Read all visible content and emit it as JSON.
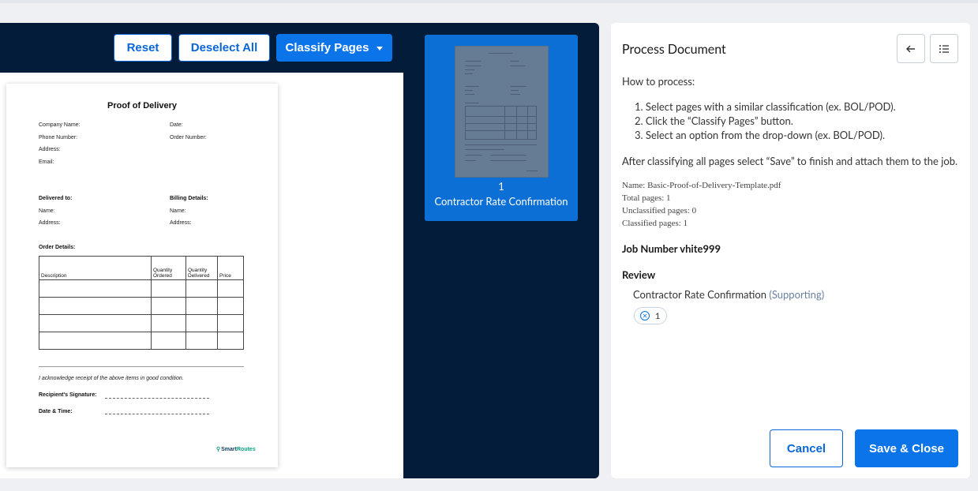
{
  "toolbar": {
    "reset_label": "Reset",
    "deselect_label": "Deselect All",
    "classify_label": "Classify Pages"
  },
  "document": {
    "title": "Proof of Delivery",
    "company_name": "Company Name:",
    "date": "Date:",
    "phone_number": "Phone Number:",
    "order_number": "Order Number:",
    "address": "Address:",
    "email": "Email:",
    "delivered_to": "Delivered to:",
    "billing_details": "Billing Details:",
    "name": "Name:",
    "order_details": "Order Details:",
    "table_headers": [
      "Description",
      "Quantity Ordered",
      "Quantity Delivered",
      "Price"
    ],
    "acknowledge": "I acknowledge receipt of the above items in good condition.",
    "recipient_signature": "Recipient's Signature:",
    "date_time": "Date & Time:",
    "logo_text": "SmartRoutes",
    "logo_prefix": "Smart",
    "logo_suffix": "Routes"
  },
  "thumbnail": {
    "page_number": "1",
    "classification": "Contractor Rate Confirmation"
  },
  "side_panel": {
    "title": "Process Document",
    "how_to": "How to process:",
    "steps": [
      "1. Select pages with a similar classification (ex. BOL/POD).",
      "2. Click the “Classify Pages” button.",
      "3. Select an option from the drop-down (ex. BOL/POD)."
    ],
    "after_note": "After classifying all pages select “Save” to finish and attach them to the job.",
    "file_name": "Name: Basic-Proof-of-Delivery-Template.pdf",
    "total_pages": "Total pages: 1",
    "unclassified_pages": "Unclassified pages: 0",
    "classified_pages": "Classified pages: 1",
    "job_number": "Job Number vhite999",
    "review_heading": "Review",
    "review_item": "Contractor Rate Confirmation",
    "review_item_sub": "(Supporting)",
    "chip_page": "1",
    "cancel_label": "Cancel",
    "save_label": "Save & Close"
  },
  "colors": {
    "navy": "#021c3a",
    "primary": "#0b74e8",
    "logo_green": "#0aa37f"
  },
  "icons": {
    "back": "arrow-left-icon",
    "list": "list-icon",
    "chip_remove": "close-circle-icon",
    "dropdown": "caret-down-icon"
  }
}
